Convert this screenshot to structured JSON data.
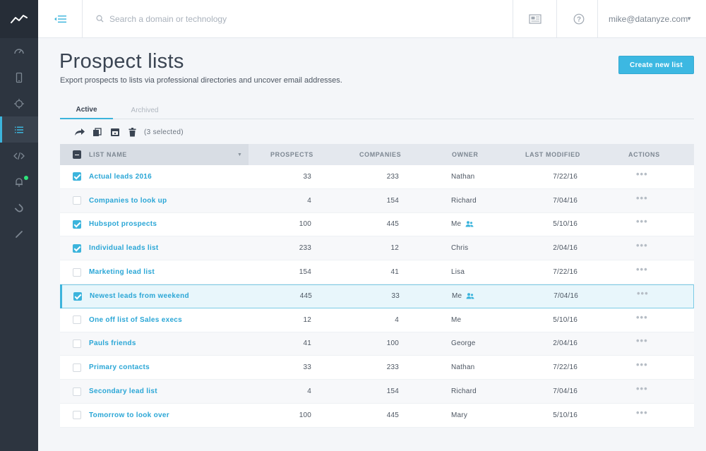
{
  "search": {
    "placeholder": "Search a domain or technology"
  },
  "user": {
    "email": "mike@datanyze.com"
  },
  "page": {
    "title": "Prospect lists",
    "subtitle": "Export prospects to lists via professional directories and uncover email addresses.",
    "create_button": "Create new list"
  },
  "tabs": {
    "active": "Active",
    "archived": "Archived"
  },
  "bulk": {
    "selected_count": "(3 selected)"
  },
  "table": {
    "headers": {
      "list_name": "LIST NAME",
      "prospects": "PROSPECTS",
      "companies": "COMPANIES",
      "owner": "OWNER",
      "last_modified": "LAST MODIFIED",
      "actions": "ACTIONS"
    },
    "actions_glyph": "•••",
    "rows": [
      {
        "name": "Actual leads 2016",
        "prospects": "33",
        "companies": "233",
        "owner": "Nathan",
        "modified": "7/22/16",
        "checked": true,
        "shared": false
      },
      {
        "name": "Companies to look up",
        "prospects": "4",
        "companies": "154",
        "owner": "Richard",
        "modified": "7/04/16",
        "checked": false,
        "shared": false
      },
      {
        "name": "Hubspot prospects",
        "prospects": "100",
        "companies": "445",
        "owner": "Me",
        "modified": "5/10/16",
        "checked": true,
        "shared": true
      },
      {
        "name": "Individual leads list",
        "prospects": "233",
        "companies": "12",
        "owner": "Chris",
        "modified": "2/04/16",
        "checked": true,
        "shared": false
      },
      {
        "name": "Marketing lead list",
        "prospects": "154",
        "companies": "41",
        "owner": "Lisa",
        "modified": "7/22/16",
        "checked": false,
        "shared": false
      },
      {
        "name": "Newest leads from weekend",
        "prospects": "445",
        "companies": "33",
        "owner": "Me",
        "modified": "7/04/16",
        "checked": true,
        "shared": true,
        "highlight": true
      },
      {
        "name": "One off list of Sales execs",
        "prospects": "12",
        "companies": "4",
        "owner": "Me",
        "modified": "5/10/16",
        "checked": false,
        "shared": false
      },
      {
        "name": "Pauls friends",
        "prospects": "41",
        "companies": "100",
        "owner": "George",
        "modified": "2/04/16",
        "checked": false,
        "shared": false
      },
      {
        "name": "Primary contacts",
        "prospects": "33",
        "companies": "233",
        "owner": "Nathan",
        "modified": "7/22/16",
        "checked": false,
        "shared": false
      },
      {
        "name": "Secondary lead list",
        "prospects": "4",
        "companies": "154",
        "owner": "Richard",
        "modified": "7/04/16",
        "checked": false,
        "shared": false
      },
      {
        "name": "Tomorrow to look over",
        "prospects": "100",
        "companies": "445",
        "owner": "Mary",
        "modified": "5/10/16",
        "checked": false,
        "shared": false
      }
    ]
  },
  "sidebar": {
    "items": [
      {
        "icon": "dashboard-icon"
      },
      {
        "icon": "mobile-icon"
      },
      {
        "icon": "crosshair-icon"
      },
      {
        "icon": "list-icon",
        "active": true
      },
      {
        "icon": "code-icon"
      },
      {
        "icon": "bell-icon",
        "notification": true
      },
      {
        "icon": "magnet-icon"
      },
      {
        "icon": "pencil-icon"
      }
    ]
  },
  "colors": {
    "accent": "#3cb4dc",
    "sidebar": "#2d3540",
    "notification": "#2ee47b"
  }
}
